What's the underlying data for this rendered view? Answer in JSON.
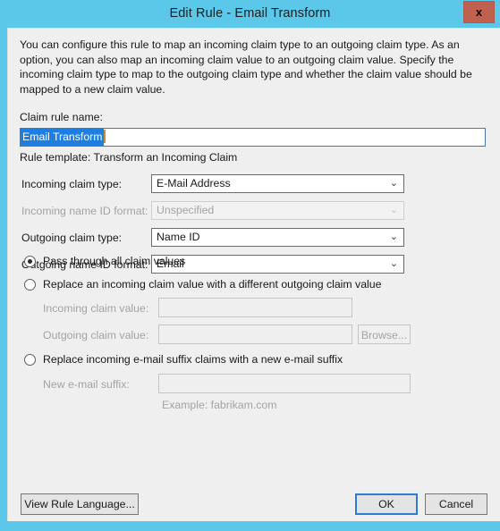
{
  "window": {
    "title": "Edit Rule - Email Transform",
    "close_label": "x",
    "titlebar_color": "#5bc8ea",
    "close_button_color": "#c0604f",
    "panel_color": "#efeff0"
  },
  "description": "You can configure this rule to map an incoming claim type to an outgoing claim type. As an option, you can also map an incoming claim value to an outgoing claim value. Specify the incoming claim type to map to the outgoing claim type and whether the claim value should be mapped to a new claim value.",
  "claim_rule_name": {
    "label": "Claim rule name:",
    "value": "Email Transform",
    "selected": true,
    "selection_color": "#1f7fe0"
  },
  "rule_template": "Rule template: Transform an Incoming Claim",
  "fields": [
    {
      "label": "Incoming claim type:",
      "value": "E-Mail Address",
      "disabled": false
    },
    {
      "label": "Incoming name ID format:",
      "value": "Unspecified",
      "disabled": true
    },
    {
      "label": "Outgoing claim type:",
      "value": "Name ID",
      "disabled": false
    },
    {
      "label": "Outgoing name ID format:",
      "value": "Email",
      "disabled": false
    }
  ],
  "options": {
    "pass_through": {
      "label": "Pass through all claim values",
      "selected": true
    },
    "replace_value": {
      "label": "Replace an incoming claim value with a different outgoing claim value",
      "selected": false,
      "incoming_label": "Incoming claim value:",
      "incoming_value": "",
      "outgoing_label": "Outgoing claim value:",
      "outgoing_value": "",
      "browse_label": "Browse..."
    },
    "replace_suffix": {
      "label": "Replace incoming e-mail suffix claims with a new e-mail suffix",
      "selected": false,
      "suffix_label": "New e-mail suffix:",
      "suffix_value": "",
      "example": "Example: fabrikam.com"
    }
  },
  "buttons": {
    "view_rule_language": "View Rule Language...",
    "ok": "OK",
    "cancel": "Cancel"
  },
  "icons": {
    "chevron_down": "⌄"
  }
}
